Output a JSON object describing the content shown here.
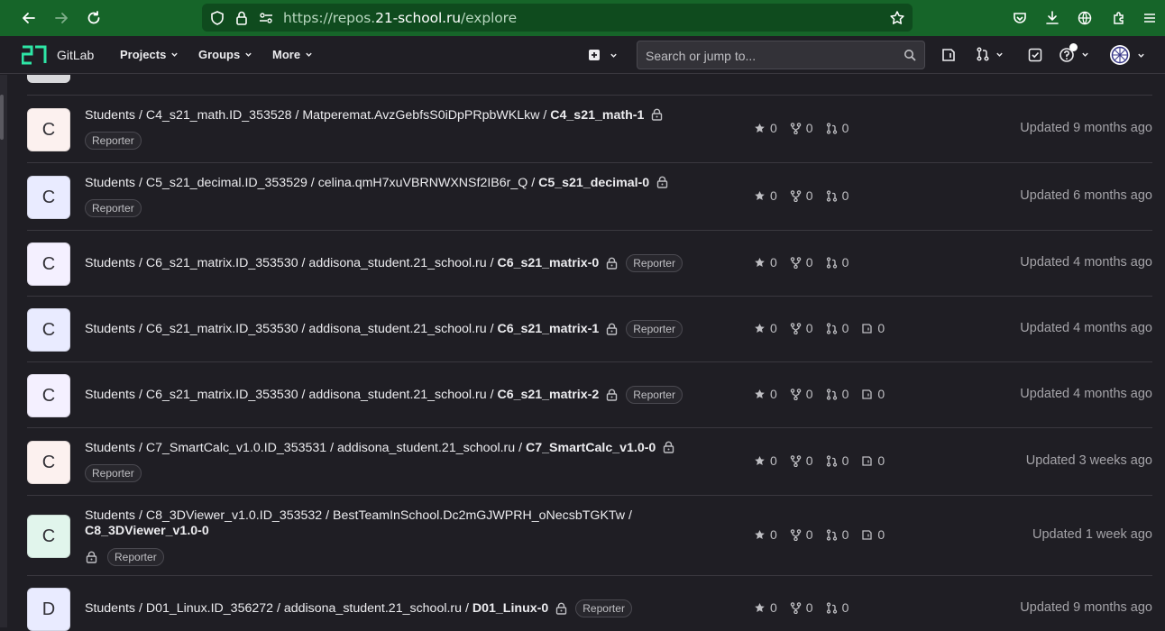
{
  "browser": {
    "url_prefix": "https://repos.",
    "url_domain": "21-school.ru",
    "url_path": "/explore"
  },
  "header": {
    "brand": "GitLab",
    "nav": [
      "Projects",
      "Groups",
      "More"
    ],
    "search_placeholder": "Search or jump to..."
  },
  "rows": [
    {
      "avatar_letter": "C",
      "avatar_color": "#fcf1ef",
      "path_prefix": "Students / C4_s21_math.ID_353528 / Matperemat.AvzGebfsS0iDpPRpbWKLkw / ",
      "project": "C4_s21_math-1",
      "role": "Reporter",
      "stars": "0",
      "forks": "0",
      "mrs": "0",
      "issues": "",
      "updated": "Updated 9 months ago"
    },
    {
      "avatar_color": "#e9ebff",
      "avatar_letter": "C",
      "path_prefix": "Students / C5_s21_decimal.ID_353529 / celina.qmH7xuVBRNWXNSf2IB6r_Q / ",
      "project": "C5_s21_decimal-0",
      "role": "Reporter",
      "stars": "0",
      "forks": "0",
      "mrs": "0",
      "issues": "",
      "updated": "Updated 6 months ago"
    },
    {
      "avatar_letter": "C",
      "avatar_color": "#f4f0ff",
      "path_prefix": "Students / C6_s21_matrix.ID_353530 / addisona_student.21_school.ru / ",
      "project": "C6_s21_matrix-0",
      "role": "Reporter",
      "stars": "0",
      "forks": "0",
      "mrs": "0",
      "issues": "",
      "updated": "Updated 4 months ago"
    },
    {
      "avatar_letter": "C",
      "avatar_color": "#e9ebff",
      "path_prefix": "Students / C6_s21_matrix.ID_353530 / addisona_student.21_school.ru / ",
      "project": "C6_s21_matrix-1",
      "role": "Reporter",
      "stars": "0",
      "forks": "0",
      "mrs": "0",
      "issues": "0",
      "updated": "Updated 4 months ago"
    },
    {
      "avatar_letter": "C",
      "avatar_color": "#f4f0ff",
      "path_prefix": "Students / C6_s21_matrix.ID_353530 / addisona_student.21_school.ru / ",
      "project": "C6_s21_matrix-2",
      "role": "Reporter",
      "stars": "0",
      "forks": "0",
      "mrs": "0",
      "issues": "0",
      "updated": "Updated 4 months ago"
    },
    {
      "avatar_letter": "C",
      "avatar_color": "#fcf1ef",
      "path_prefix": "Students / C7_SmartCalc_v1.0.ID_353531 / addisona_student.21_school.ru / ",
      "project": "C7_SmartCalc_v1.0-0",
      "role": "Reporter",
      "stars": "0",
      "forks": "0",
      "mrs": "0",
      "issues": "0",
      "updated": "Updated 3 weeks ago"
    },
    {
      "avatar_letter": "C",
      "avatar_color": "#e1f5ec",
      "path_prefix": "Students / C8_3DViewer_v1.0.ID_353532 / BestTeamInSchool.Dc2mGJWPRH_oNecsbTGKTw / ",
      "project": "C8_3DViewer_v1.0-0",
      "role": "Reporter",
      "stars": "0",
      "forks": "0",
      "mrs": "0",
      "issues": "0",
      "updated": "Updated 1 week ago"
    },
    {
      "avatar_letter": "D",
      "avatar_color": "#e9ebff",
      "path_prefix": "Students / D01_Linux.ID_356272 / addisona_student.21_school.ru / ",
      "project": "D01_Linux-0",
      "role": "Reporter",
      "stars": "0",
      "forks": "0",
      "mrs": "0",
      "issues": "",
      "updated": "Updated 9 months ago"
    }
  ]
}
